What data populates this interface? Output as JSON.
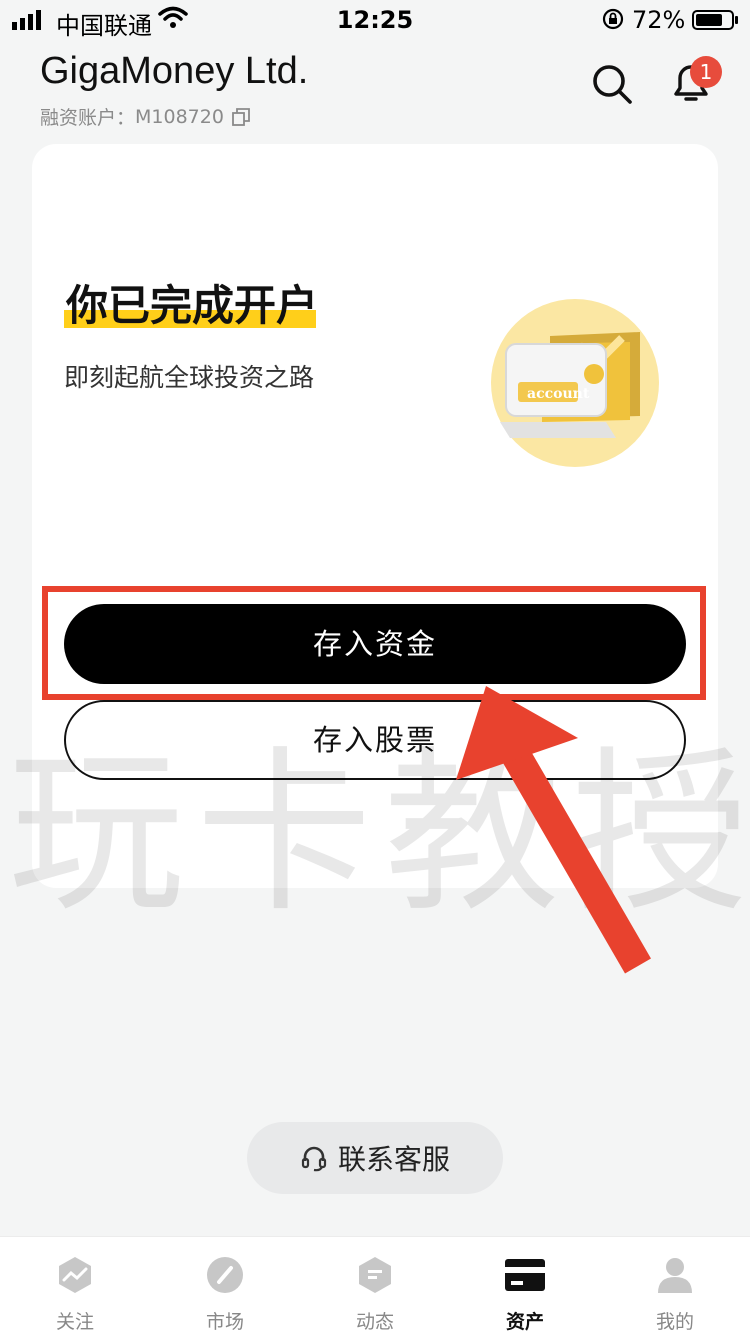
{
  "status_bar": {
    "carrier": "中国联通",
    "time": "12:25",
    "battery": "72%"
  },
  "header": {
    "brand": "GigaMoney Ltd.",
    "account_label": "融资账户：",
    "account_id": "M108720",
    "notification_count": "1"
  },
  "card": {
    "title": "你已完成开户",
    "subtitle": "即刻起航全球投资之路",
    "illustration_text": "account",
    "deposit_funds_label": "存入资金",
    "deposit_stocks_label": "存入股票"
  },
  "watermark": "玩卡教授",
  "support": {
    "label": "联系客服"
  },
  "tabs": [
    {
      "label": "关注",
      "icon": "chart-icon"
    },
    {
      "label": "市场",
      "icon": "compass-icon"
    },
    {
      "label": "动态",
      "icon": "feed-icon"
    },
    {
      "label": "资产",
      "icon": "card-icon"
    },
    {
      "label": "我的",
      "icon": "profile-icon"
    }
  ],
  "colors": {
    "accent_yellow": "#ffcf1a",
    "badge_red": "#e74c3c",
    "annotation_red": "#e8422e"
  }
}
